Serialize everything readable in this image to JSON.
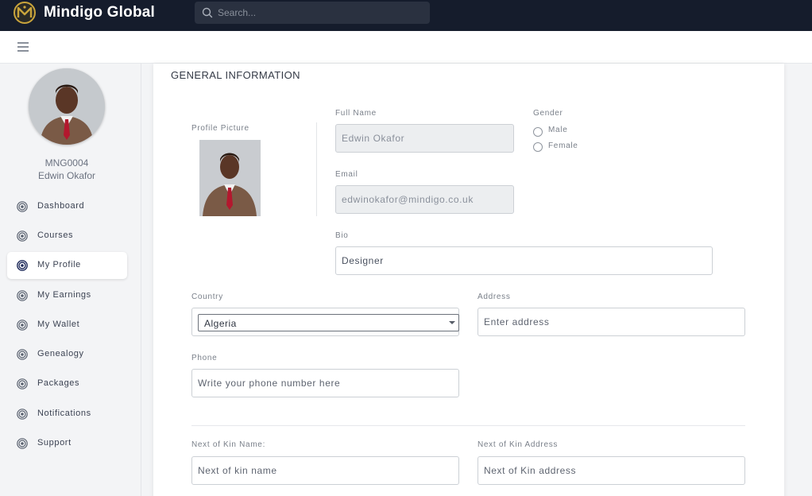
{
  "app": {
    "brand": "Mindigo Global"
  },
  "search": {
    "placeholder": "Search..."
  },
  "user": {
    "id": "MNG0004",
    "name": "Edwin Okafor"
  },
  "sidebar": {
    "items": [
      {
        "label": "Dashboard",
        "icon": "target-icon",
        "active": false
      },
      {
        "label": "Courses",
        "icon": "target-icon",
        "active": false
      },
      {
        "label": "My Profile",
        "icon": "target-icon",
        "active": true
      },
      {
        "label": "My Earnings",
        "icon": "target-icon",
        "active": false
      },
      {
        "label": "My Wallet",
        "icon": "target-icon",
        "active": false
      },
      {
        "label": "Genealogy",
        "icon": "target-icon",
        "active": false
      },
      {
        "label": "Packages",
        "icon": "target-icon",
        "active": false
      },
      {
        "label": "Notifications",
        "icon": "target-icon",
        "active": false
      },
      {
        "label": "Support",
        "icon": "target-icon",
        "active": false
      }
    ]
  },
  "form": {
    "section_title": "GENERAL INFORMATION",
    "profile_picture_label": "Profile Picture",
    "full_name": {
      "label": "Full Name",
      "value": "Edwin Okafor"
    },
    "email": {
      "label": "Email",
      "value": "edwinokafor@mindigo.co.uk"
    },
    "gender": {
      "label": "Gender",
      "options": [
        "Male",
        "Female"
      ]
    },
    "bio": {
      "label": "Bio",
      "value": "Designer"
    },
    "country": {
      "label": "Country",
      "value": "Algeria"
    },
    "address": {
      "label": "Address",
      "placeholder": "Enter address"
    },
    "phone": {
      "label": "Phone",
      "placeholder": "Write your phone number here"
    },
    "kin_name": {
      "label": "Next of Kin Name:",
      "placeholder": "Next of kin name"
    },
    "kin_address": {
      "label": "Next of Kin Address",
      "placeholder": "Next of Kin address"
    }
  },
  "colors": {
    "topbar": "#151c2c",
    "accent": "#1e2a5a",
    "logo_gold": "#c9a43c"
  }
}
